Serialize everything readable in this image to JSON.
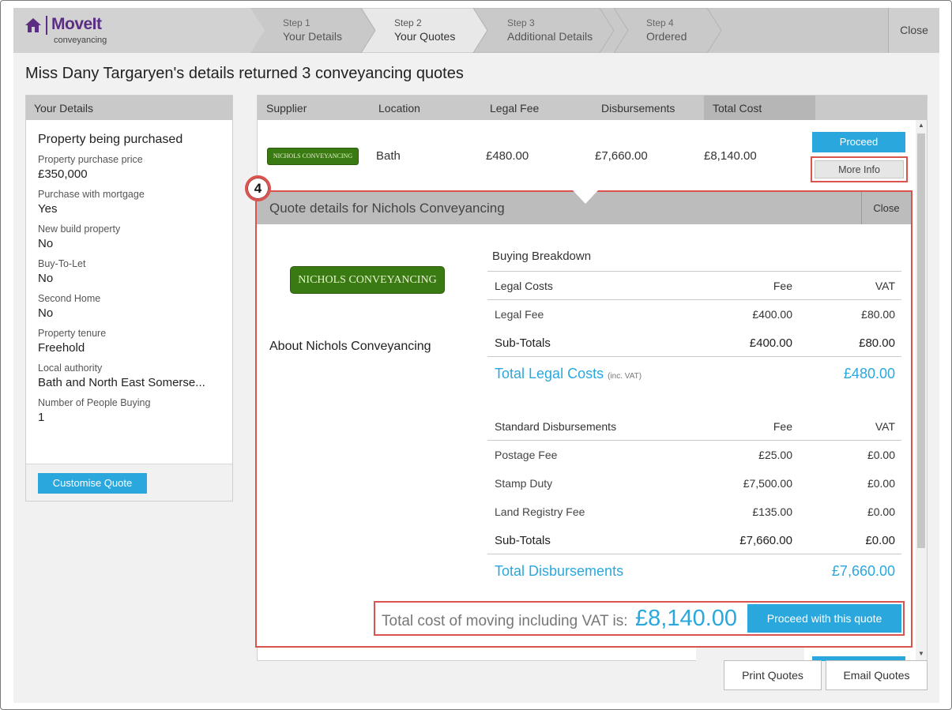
{
  "header": {
    "brand": "MoveIt",
    "brand_sub": "conveyancing",
    "close_label": "Close",
    "steps": [
      {
        "num": "Step 1",
        "label": "Your Details"
      },
      {
        "num": "Step 2",
        "label": "Your Quotes"
      },
      {
        "num": "Step 3",
        "label": "Additional Details"
      },
      {
        "num": "Step 4",
        "label": "Ordered"
      }
    ],
    "active_step": 2
  },
  "page_title": "Miss Dany Targaryen's details returned 3 conveyancing quotes",
  "details": {
    "header": "Your Details",
    "section": "Property being purchased",
    "fields": [
      {
        "label": "Property purchase price",
        "value": "£350,000"
      },
      {
        "label": "Purchase with mortgage",
        "value": "Yes"
      },
      {
        "label": "New build property",
        "value": "No"
      },
      {
        "label": "Buy-To-Let",
        "value": "No"
      },
      {
        "label": "Second Home",
        "value": "No"
      },
      {
        "label": "Property tenure",
        "value": "Freehold"
      },
      {
        "label": "Local authority",
        "value": "Bath and North East Somerse..."
      },
      {
        "label": "Number of People Buying",
        "value": "1"
      }
    ],
    "customise_label": "Customise Quote"
  },
  "results": {
    "columns": [
      "Supplier",
      "Location",
      "Legal Fee",
      "Disbursements",
      "Total Cost"
    ],
    "rows": [
      {
        "supplier_logo": "NICHOLS CONVEYANCING",
        "location": "Bath",
        "legal_fee": "£480.00",
        "disbursements": "£7,660.00",
        "total": "£8,140.00",
        "proceed_label": "Proceed",
        "more_info_label": "More Info"
      }
    ]
  },
  "popup": {
    "title": "Quote details for Nichols Conveyancing",
    "close_label": "Close",
    "badge": "4",
    "logo_text": "NICHOLS CONVEYANCING",
    "about": "About Nichols Conveyancing",
    "breakdown_title": "Buying Breakdown",
    "legal": {
      "header": [
        "Legal Costs",
        "Fee",
        "VAT"
      ],
      "rows": [
        [
          "Legal Fee",
          "£400.00",
          "£80.00"
        ]
      ],
      "subtotal": [
        "Sub-Totals",
        "£400.00",
        "£80.00"
      ],
      "total_label": "Total Legal Costs",
      "total_note": "(inc. VAT)",
      "total_value": "£480.00"
    },
    "disbursements": {
      "header": [
        "Standard Disbursements",
        "Fee",
        "VAT"
      ],
      "rows": [
        [
          "Postage Fee",
          "£25.00",
          "£0.00"
        ],
        [
          "Stamp Duty",
          "£7,500.00",
          "£0.00"
        ],
        [
          "Land Registry Fee",
          "£135.00",
          "£0.00"
        ]
      ],
      "subtotal": [
        "Sub-Totals",
        "£7,660.00",
        "£0.00"
      ],
      "total_label": "Total Disbursements",
      "total_value": "£7,660.00"
    },
    "total_cost_label": "Total cost of moving including VAT is:",
    "total_cost_value": "£8,140.00",
    "proceed_label": "Proceed with this quote"
  },
  "footer": {
    "print_label": "Print Quotes",
    "email_label": "Email Quotes"
  },
  "colors": {
    "accent": "#2aa8de",
    "brand": "#5b2d83",
    "highlight": "#d9534f",
    "supplier_green": "#3a7a12"
  }
}
